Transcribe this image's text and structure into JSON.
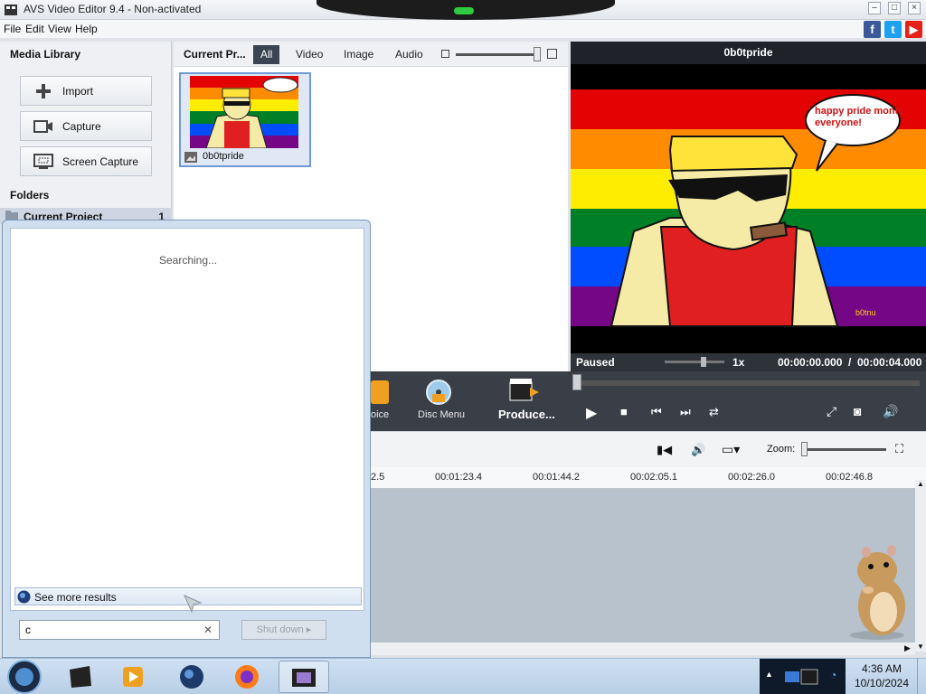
{
  "window": {
    "title": "AVS Video Editor 9.4 - Non-activated"
  },
  "menu": {
    "items": [
      "File",
      "Edit",
      "View",
      "Help"
    ]
  },
  "media_library": {
    "title": "Media Library",
    "buttons": [
      "Import",
      "Capture",
      "Screen Capture"
    ],
    "folders_title": "Folders",
    "current_project": {
      "label": "Current Project",
      "count": "1"
    }
  },
  "library": {
    "title": "Current Pr...",
    "tabs": [
      "All",
      "Video",
      "Image",
      "Audio"
    ],
    "active_tab": "All",
    "items": [
      {
        "name": "0b0tpride"
      }
    ]
  },
  "preview": {
    "title": "0b0tpride",
    "bubble_text": "happy pride month everyone!",
    "watermark": "b0tnu",
    "status": "Paused",
    "speed": "1x",
    "current_time": "00:00:00.000",
    "separator": "/",
    "total_time": "00:00:04.000"
  },
  "toolbar": {
    "voice_label": "oice",
    "disc_menu_label": "Disc Menu",
    "produce_label": "Produce..."
  },
  "timeline": {
    "zoom_label": "Zoom:",
    "ruler": [
      "2.5",
      "00:01:23.4",
      "00:01:44.2",
      "00:02:05.1",
      "00:02:26.0",
      "00:02:46.8"
    ]
  },
  "search_popup": {
    "status": "Searching...",
    "see_more": "See more results",
    "query": "c",
    "shutdown_label": "Shut down"
  },
  "taskbar": {
    "time": "4:36 AM",
    "date": "10/10/2024"
  },
  "colors": {
    "accent_dark": "#3a3f47",
    "selection_blue": "#6e9bd6",
    "facebook": "#3b5998",
    "twitter": "#1da1f2",
    "youtube": "#e62117"
  }
}
